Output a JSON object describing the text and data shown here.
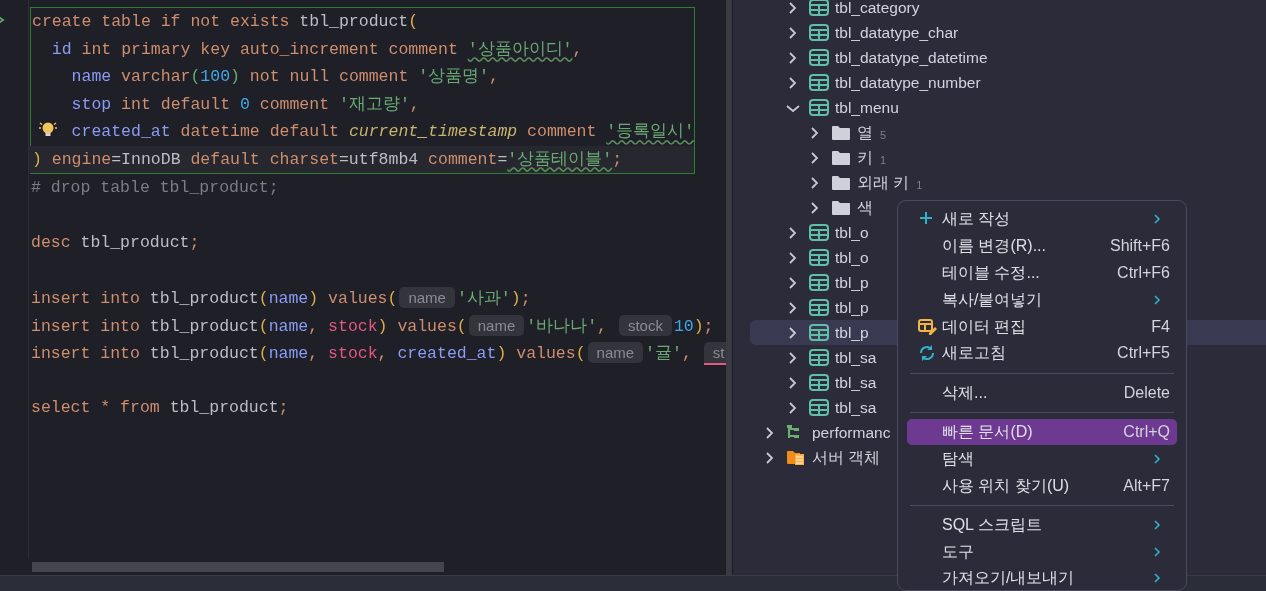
{
  "editor": {
    "lines": [
      {
        "kind": "statement",
        "lines": [
          {
            "kind": "code",
            "tokens": [
              {
                "kind": "kw",
                "text": "create table if not exists "
              },
              {
                "kind": "ident",
                "text": "tbl_product"
              },
              {
                "kind": "paren",
                "text": "("
              }
            ]
          },
          {
            "kind": "code",
            "tokens": [
              {
                "kind": "col",
                "text": "  id"
              },
              {
                "kind": "kw",
                "text": " int primary key auto_increment comment "
              },
              {
                "kind": "strw",
                "text": "'상품아이디'"
              },
              {
                "kind": "kw",
                "text": ","
              }
            ]
          },
          {
            "kind": "code",
            "tokens": [
              {
                "kind": "col",
                "text": "    name"
              },
              {
                "kind": "kw",
                "text": " varchar"
              },
              {
                "kind": "paren2",
                "text": "("
              },
              {
                "kind": "num",
                "text": "100"
              },
              {
                "kind": "paren2",
                "text": ")"
              },
              {
                "kind": "kw",
                "text": " not null comment "
              },
              {
                "kind": "str",
                "text": "'상품명'"
              },
              {
                "kind": "kw",
                "text": ","
              }
            ]
          },
          {
            "kind": "code",
            "tokens": [
              {
                "kind": "col",
                "text": "    stop"
              },
              {
                "kind": "kw",
                "text": " int default "
              },
              {
                "kind": "num",
                "text": "0"
              },
              {
                "kind": "kw",
                "text": " comment "
              },
              {
                "kind": "str",
                "text": "'재고량'"
              },
              {
                "kind": "kw",
                "text": ","
              }
            ]
          },
          {
            "kind": "code",
            "bulb": true,
            "tokens": [
              {
                "kind": "col",
                "text": "    created_at"
              },
              {
                "kind": "kw",
                "text": " datetime default "
              },
              {
                "kind": "func",
                "text": "current_timestamp"
              },
              {
                "kind": "kw",
                "text": " comment "
              },
              {
                "kind": "strw",
                "text": "'등록일시'"
              }
            ]
          },
          {
            "kind": "code",
            "current": true,
            "tokens": [
              {
                "kind": "paren",
                "text": ")"
              },
              {
                "kind": "kw",
                "text": " engine"
              },
              {
                "kind": "ident",
                "text": "=InnoDB "
              },
              {
                "kind": "kw",
                "text": "default charset"
              },
              {
                "kind": "ident",
                "text": "=utf8mb4 "
              },
              {
                "kind": "kw",
                "text": "comment"
              },
              {
                "kind": "ident",
                "text": "="
              },
              {
                "kind": "strw",
                "text": "'상품테이블'"
              },
              {
                "kind": "kw",
                "text": ";"
              }
            ]
          }
        ]
      },
      {
        "kind": "code",
        "tokens": [
          {
            "kind": "comment",
            "text": "# drop table tbl_product;"
          }
        ]
      },
      {
        "kind": "blank"
      },
      {
        "kind": "code",
        "tokens": [
          {
            "kind": "kw",
            "text": "desc "
          },
          {
            "kind": "ident",
            "text": "tbl_product"
          },
          {
            "kind": "kw",
            "text": ";"
          }
        ]
      },
      {
        "kind": "blank"
      },
      {
        "kind": "code",
        "tokens": [
          {
            "kind": "kw",
            "text": "insert into "
          },
          {
            "kind": "ident",
            "text": "tbl_product"
          },
          {
            "kind": "paren",
            "text": "("
          },
          {
            "kind": "col",
            "text": "name"
          },
          {
            "kind": "paren",
            "text": ")"
          },
          {
            "kind": "kw",
            "text": " values"
          },
          {
            "kind": "paren",
            "text": "("
          },
          {
            "kind": "hint",
            "text": "name"
          },
          {
            "kind": "str",
            "text": "'사과'"
          },
          {
            "kind": "paren",
            "text": ")"
          },
          {
            "kind": "kw",
            "text": ";"
          }
        ]
      },
      {
        "kind": "code",
        "tokens": [
          {
            "kind": "kw",
            "text": "insert into "
          },
          {
            "kind": "ident",
            "text": "tbl_product"
          },
          {
            "kind": "paren",
            "text": "("
          },
          {
            "kind": "col",
            "text": "name"
          },
          {
            "kind": "kw",
            "text": ", "
          },
          {
            "kind": "col2",
            "text": "stock"
          },
          {
            "kind": "paren",
            "text": ")"
          },
          {
            "kind": "kw",
            "text": " values"
          },
          {
            "kind": "paren",
            "text": "("
          },
          {
            "kind": "hint",
            "text": "name"
          },
          {
            "kind": "str",
            "text": "'바나나'"
          },
          {
            "kind": "kw",
            "text": ", "
          },
          {
            "kind": "hint",
            "text": "stock"
          },
          {
            "kind": "num",
            "text": "10"
          },
          {
            "kind": "paren",
            "text": ")"
          },
          {
            "kind": "kw",
            "text": ";"
          }
        ]
      },
      {
        "kind": "code",
        "tokens": [
          {
            "kind": "kw",
            "text": "insert into "
          },
          {
            "kind": "ident",
            "text": "tbl_product"
          },
          {
            "kind": "paren",
            "text": "("
          },
          {
            "kind": "col",
            "text": "name"
          },
          {
            "kind": "kw",
            "text": ", "
          },
          {
            "kind": "col2",
            "text": "stock"
          },
          {
            "kind": "kw",
            "text": ", "
          },
          {
            "kind": "col",
            "text": "created_at"
          },
          {
            "kind": "paren",
            "text": ")"
          },
          {
            "kind": "kw",
            "text": " values"
          },
          {
            "kind": "paren",
            "text": "("
          },
          {
            "kind": "hint",
            "text": "name"
          },
          {
            "kind": "str",
            "text": "'귤'"
          },
          {
            "kind": "kw",
            "text": ", "
          },
          {
            "kind": "hinterr",
            "text": "st"
          }
        ]
      },
      {
        "kind": "blank"
      },
      {
        "kind": "code",
        "tokens": [
          {
            "kind": "kw",
            "text": "select "
          },
          {
            "kind": "op",
            "text": "*"
          },
          {
            "kind": "kw",
            "text": " from "
          },
          {
            "kind": "ident",
            "text": "tbl_product"
          },
          {
            "kind": "kw",
            "text": ";"
          }
        ]
      }
    ]
  },
  "tree": {
    "items": [
      {
        "children": [
          {
            "label": "tbl_category",
            "kind": "table",
            "expanded": false,
            "selected": false
          },
          {
            "label": "tbl_datatype_char",
            "kind": "table",
            "expanded": false,
            "selected": false
          },
          {
            "label": "tbl_datatype_datetime",
            "kind": "table",
            "expanded": false,
            "selected": false
          },
          {
            "label": "tbl_datatype_number",
            "kind": "table",
            "expanded": false,
            "selected": false
          },
          {
            "label": "tbl_menu",
            "kind": "table",
            "expanded": true,
            "selected": false,
            "children": [
              {
                "label": "열",
                "count": "5",
                "kind": "folder",
                "expanded": false,
                "selected": false
              },
              {
                "label": "키",
                "count": "1",
                "kind": "folder",
                "expanded": false,
                "selected": false
              },
              {
                "label": "외래 키",
                "count": "1",
                "kind": "folder",
                "expanded": false,
                "selected": false
              },
              {
                "label": "색",
                "kind": "folder",
                "expanded": false,
                "selected": false
              }
            ]
          },
          {
            "label": "tbl_o",
            "kind": "table",
            "expanded": false,
            "selected": false
          },
          {
            "label": "tbl_o",
            "kind": "table",
            "expanded": false,
            "selected": false
          },
          {
            "label": "tbl_p",
            "kind": "table",
            "expanded": false,
            "selected": false
          },
          {
            "label": "tbl_p",
            "kind": "table",
            "expanded": false,
            "selected": false
          },
          {
            "label": "tbl_p",
            "kind": "table",
            "expanded": false,
            "selected": true
          },
          {
            "label": "tbl_sa",
            "kind": "table",
            "expanded": false,
            "selected": false
          },
          {
            "label": "tbl_sa",
            "kind": "table",
            "expanded": false,
            "selected": false
          },
          {
            "label": "tbl_sa",
            "kind": "table",
            "expanded": false,
            "selected": false
          }
        ]
      },
      {
        "label": "performanc",
        "kind": "schema",
        "expanded": false,
        "selected": false
      },
      {
        "label": "서버 객체",
        "kind": "server",
        "expanded": false,
        "selected": false
      }
    ]
  },
  "context_menu": {
    "items": [
      {
        "kind": "create",
        "label": "새로 작성",
        "submenu": true,
        "selected": false
      },
      {
        "kind": "item",
        "label": "이름 변경(R)...",
        "shortcut": "Shift+F6",
        "submenu": false,
        "selected": false
      },
      {
        "kind": "item",
        "label": "테이블 수정...",
        "shortcut": "Ctrl+F6",
        "submenu": false,
        "selected": false
      },
      {
        "kind": "item",
        "label": "복사/붙여넣기",
        "submenu": true,
        "selected": false
      },
      {
        "kind": "edit",
        "label": "데이터 편집",
        "shortcut": "F4",
        "submenu": false,
        "selected": false
      },
      {
        "kind": "refresh",
        "label": "새로고침",
        "shortcut": "Ctrl+F5",
        "submenu": false,
        "selected": false
      },
      {
        "kind": "separator"
      },
      {
        "kind": "item",
        "label": "삭제...",
        "shortcut": "Delete",
        "submenu": false,
        "selected": false
      },
      {
        "kind": "separator"
      },
      {
        "kind": "item",
        "label": "빠른 문서(D)",
        "shortcut": "Ctrl+Q",
        "submenu": false,
        "selected": true
      },
      {
        "kind": "item",
        "label": "탐색",
        "submenu": true,
        "selected": false
      },
      {
        "kind": "item",
        "label": "사용 위치 찾기(U)",
        "shortcut": "Alt+F7",
        "submenu": false,
        "selected": false
      },
      {
        "kind": "separator"
      },
      {
        "kind": "item",
        "label": "SQL 스크립트",
        "submenu": true,
        "selected": false
      },
      {
        "kind": "item",
        "label": "도구",
        "submenu": true,
        "selected": false
      },
      {
        "kind": "item",
        "label": "가져오기/내보내기",
        "submenu": true,
        "selected": false
      }
    ]
  }
}
